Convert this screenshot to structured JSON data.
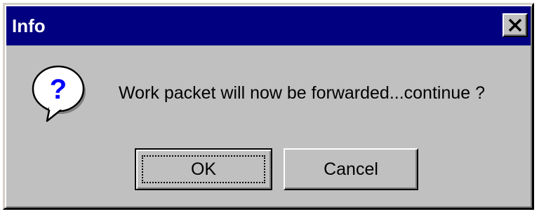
{
  "window": {
    "title": "Info",
    "close_icon": "close-icon"
  },
  "message": {
    "icon": "question-icon",
    "text": "Work packet will now be forwarded...continue ?"
  },
  "buttons": {
    "ok_label": "OK",
    "cancel_label": "Cancel"
  },
  "colors": {
    "titlebar": "#000080",
    "dialog_bg": "#c0c0c0",
    "icon_blue": "#0000ff"
  }
}
